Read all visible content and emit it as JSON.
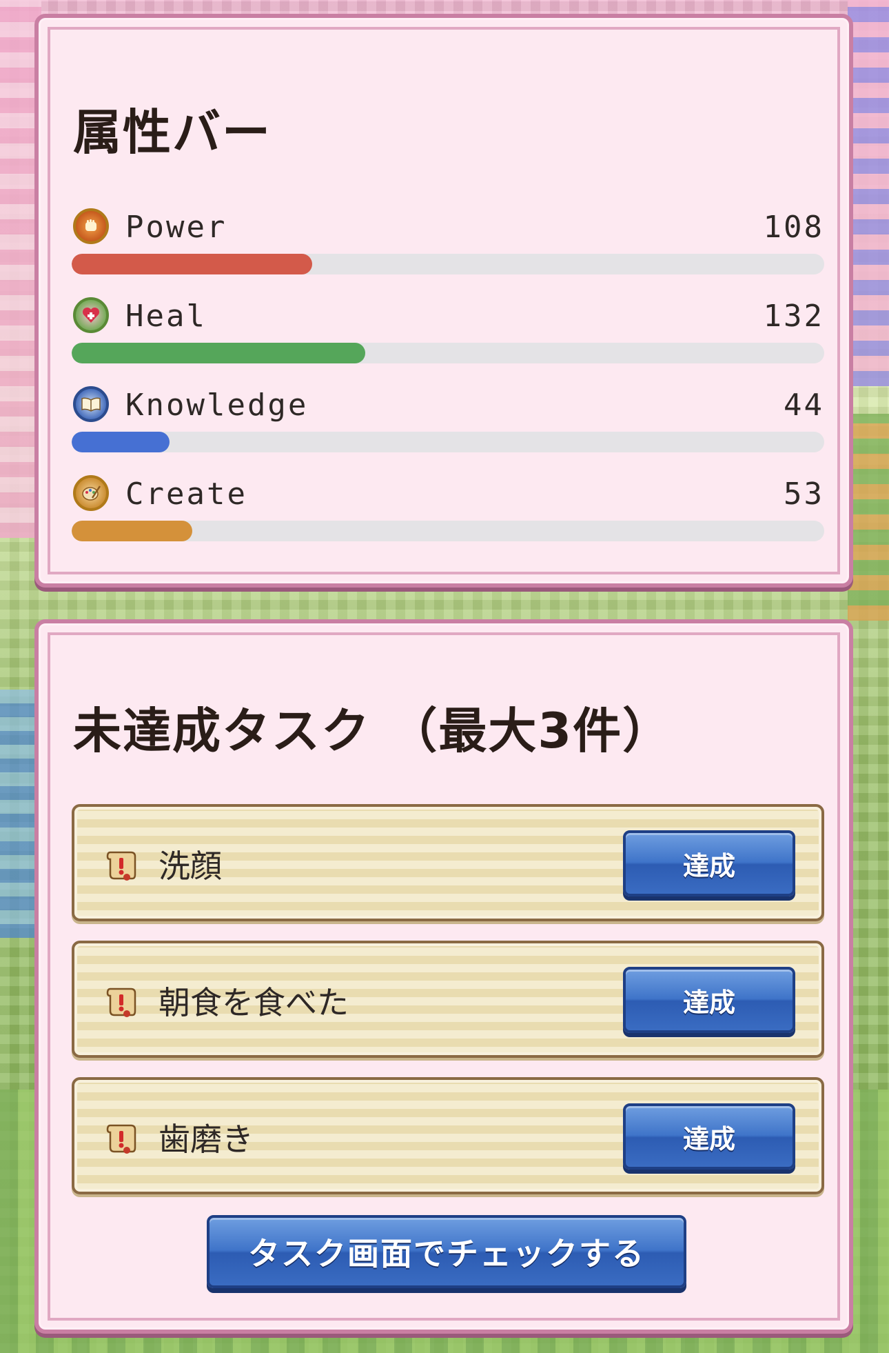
{
  "colors": {
    "power": "#d35a4a",
    "heal": "#55a65a",
    "knowledge": "#4670d3",
    "create": "#d4913a"
  },
  "attributes": {
    "title": "属性バー",
    "items": [
      {
        "name": "Power",
        "value": "108",
        "fill_fraction": 0.32,
        "color": "#d35a4a",
        "icon": "power-fist-icon"
      },
      {
        "name": "Heal",
        "value": "132",
        "fill_fraction": 0.39,
        "color": "#55a65a",
        "icon": "heal-heart-icon"
      },
      {
        "name": "Knowledge",
        "value": "44",
        "fill_fraction": 0.13,
        "color": "#4670d3",
        "icon": "knowledge-book-icon"
      },
      {
        "name": "Create",
        "value": "53",
        "fill_fraction": 0.16,
        "color": "#d4913a",
        "icon": "create-palette-icon"
      }
    ]
  },
  "tasks": {
    "title": "未達成タスク （最大3件）",
    "items": [
      {
        "label": "洗顔",
        "button_label": "達成",
        "icon": "scroll-alert-icon"
      },
      {
        "label": "朝食を食べた",
        "button_label": "達成",
        "icon": "scroll-alert-icon"
      },
      {
        "label": "歯磨き",
        "button_label": "達成",
        "icon": "scroll-alert-icon"
      }
    ],
    "check_button_label": "タスク画面でチェックする"
  }
}
